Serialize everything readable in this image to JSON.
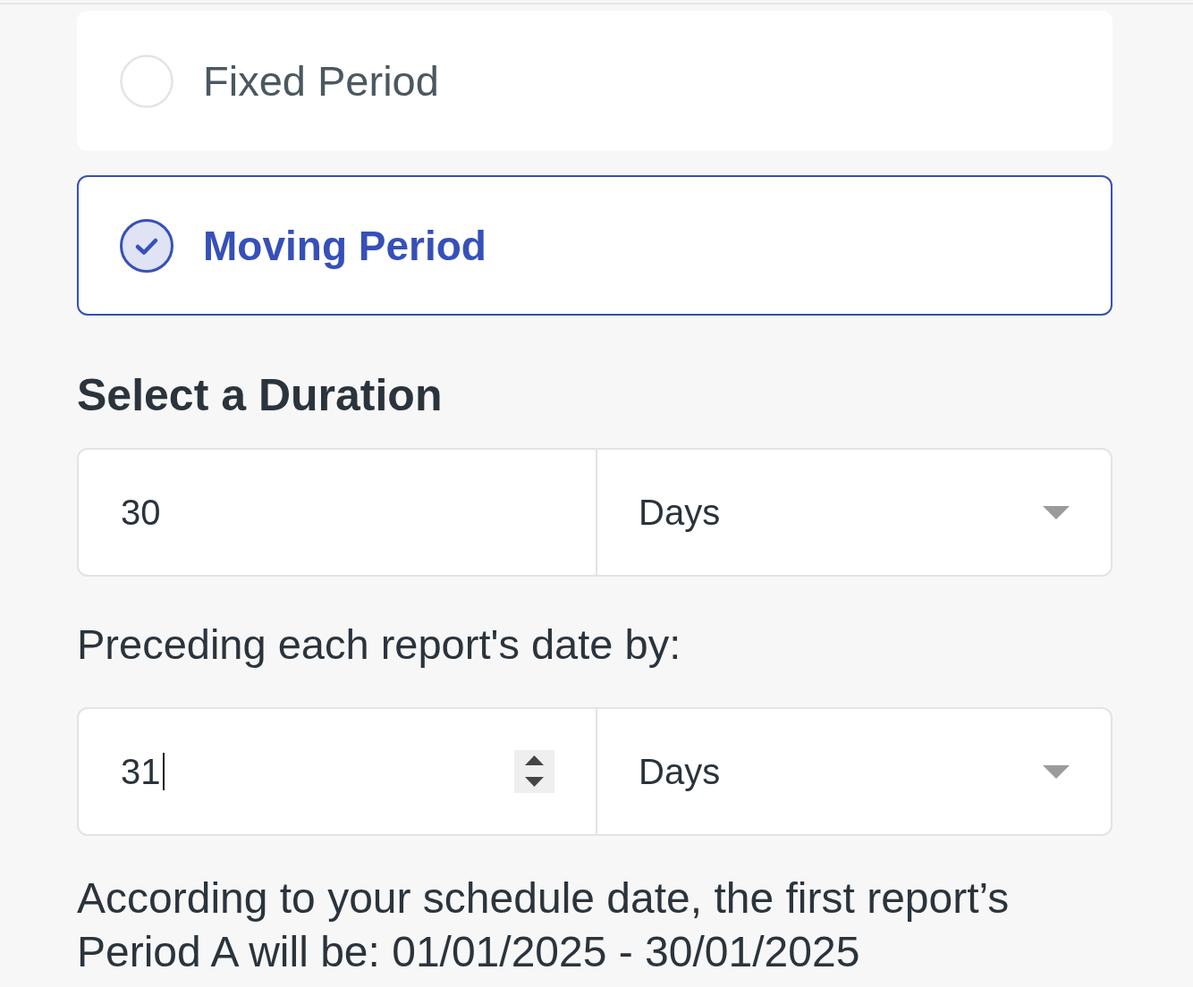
{
  "period_options": [
    {
      "label": "Fixed Period",
      "selected": false
    },
    {
      "label": "Moving Period",
      "selected": true
    }
  ],
  "duration": {
    "heading": "Select a Duration",
    "amount": "30",
    "unit": "Days",
    "focused": false
  },
  "offset": {
    "label": "Preceding each report's date by:",
    "amount": "31",
    "unit": "Days",
    "focused": true
  },
  "summary": {
    "text": "According to your schedule date, the first report’s Period A will be: 01/01/2025 - 30/01/2025"
  }
}
